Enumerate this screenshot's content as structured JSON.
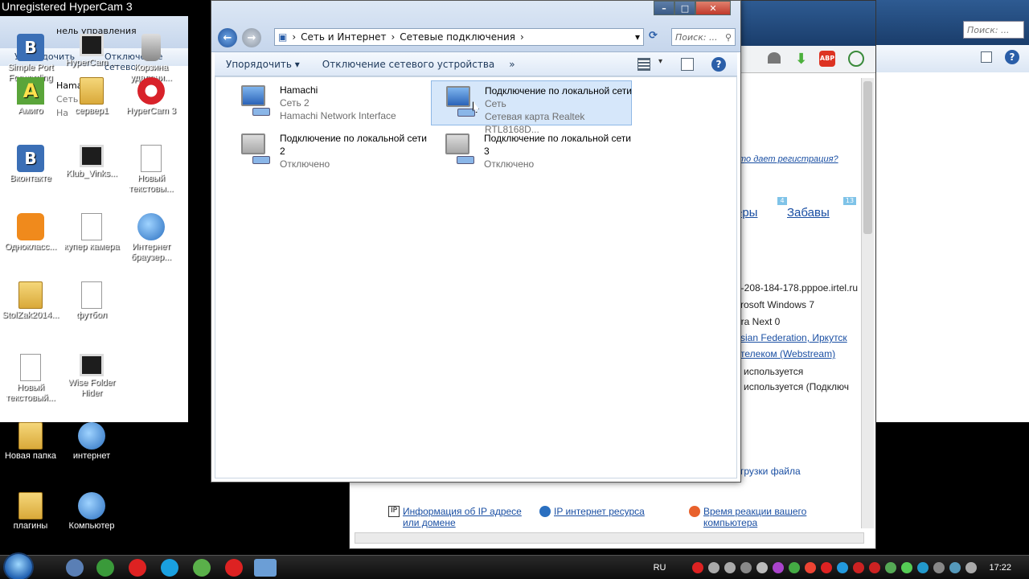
{
  "watermark": "Unregistered HyperCam 3",
  "desktop": {
    "icons": [
      {
        "label": "Simple Port Forwarding",
        "type": "blue"
      },
      {
        "label": "HyperCam ...",
        "type": "monitor"
      },
      {
        "label": "Корзина удалени...",
        "type": "bin"
      },
      {
        "label": "Амиго",
        "type": "green"
      },
      {
        "label": "сервер1",
        "type": "folder"
      },
      {
        "label": "HyperCam 3",
        "type": "red"
      },
      {
        "label": "Вконтакте",
        "type": "blue"
      },
      {
        "label": "Klub_Vinks...",
        "type": "monitor"
      },
      {
        "label": "Новый текстовы...",
        "type": "doc"
      },
      {
        "label": "Однокласс...",
        "type": "orange"
      },
      {
        "label": "купер камера",
        "type": "doc"
      },
      {
        "label": "Интернет браузер...",
        "type": "globe"
      },
      {
        "label": "StolZak2014...",
        "type": "folder"
      },
      {
        "label": "футбол",
        "type": "doc"
      },
      {
        "label": "Новый текстовый...",
        "type": "doc"
      },
      {
        "label": "Wise Folder Hider",
        "type": "monitor"
      },
      {
        "label": "Новая папка",
        "type": "folder"
      },
      {
        "label": "интернет",
        "type": "globe"
      },
      {
        "label": "плагины",
        "type": "folder"
      },
      {
        "label": "Компьютер",
        "type": "globe"
      }
    ]
  },
  "left_explorer": {
    "path_fragment": "нель управления",
    "cmd_sort": "Упорядочить",
    "cmd_disconnect": "Отключение сетево",
    "item_name": "Hama",
    "item_status": "Сеть",
    "item_desc": "На"
  },
  "window": {
    "breadcrumb": [
      "Сеть и Интернет",
      "Сетевые подключения"
    ],
    "search_placeholder": "Поиск: ...",
    "cmd_sort": "Упорядочить",
    "cmd_disconnect": "Отключение сетевого устройства",
    "cmd_more": "»",
    "connections": [
      {
        "name": "Hamachi",
        "status": "Сеть  2",
        "desc": "Hamachi Network Interface",
        "enabled": true
      },
      {
        "name": "Подключение по локальной сети",
        "status": "Сеть",
        "desc": "Сетевая карта Realtek RTL8168D...",
        "enabled": true
      },
      {
        "name": "Подключение по локальной сети 2",
        "status": "Отключено",
        "desc": "",
        "enabled": false
      },
      {
        "name": "Подключение по локальной сети 3",
        "status": "Отключено",
        "desc": "",
        "enabled": false
      }
    ]
  },
  "browser": {
    "reg_link": "то дает регистрация?",
    "tab_1": "еры",
    "tab_2": "Забавы",
    "badge_1": "4",
    "badge_2": "13",
    "info": [
      "4-208-184-178.pppoe.irtel.ru",
      "crosoft Windows 7",
      "era Next 0",
      "ssian Federation, Иркутск",
      "стелеком (Webstream)",
      "е используется",
      "е используется (Подключ"
    ],
    "upload_fragment": "грузки файла",
    "footer_1": "Информация об IP адресе или домене",
    "footer_2": "IP интернет ресурса",
    "footer_3": "Время реакции вашего компьютера"
  },
  "right_explorer": {
    "search_placeholder": "Поиск: ..."
  },
  "taskbar": {
    "lang": "RU",
    "time": "17:22"
  }
}
